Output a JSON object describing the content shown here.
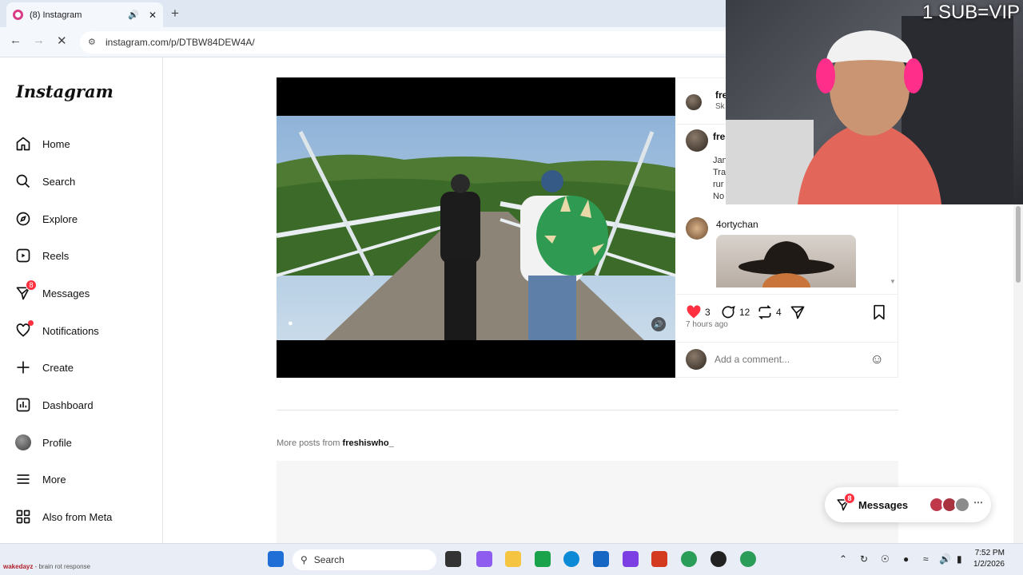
{
  "browser": {
    "tab_title": "(8) Instagram",
    "url": "instagram.com/p/DTBW84DEW4A/"
  },
  "sidebar": {
    "logo": "Instagram",
    "items": [
      {
        "label": "Home",
        "icon": "home-icon"
      },
      {
        "label": "Search",
        "icon": "search-icon"
      },
      {
        "label": "Explore",
        "icon": "compass-icon"
      },
      {
        "label": "Reels",
        "icon": "reels-icon"
      },
      {
        "label": "Messages",
        "icon": "messenger-icon",
        "badge": "8"
      },
      {
        "label": "Notifications",
        "icon": "heart-icon"
      },
      {
        "label": "Create",
        "icon": "plus-icon"
      },
      {
        "label": "Dashboard",
        "icon": "dashboard-icon"
      },
      {
        "label": "Profile",
        "icon": "avatar-icon"
      },
      {
        "label": "More",
        "icon": "menu-icon"
      },
      {
        "label": "Also from Meta",
        "icon": "meta-icon"
      }
    ]
  },
  "post": {
    "header_user": "fre",
    "header_sub": "Sk",
    "caption_user": "fre",
    "caption_lines": [
      "Jan",
      "Tra",
      "rur",
      "No"
    ],
    "comment_user": "4ortychan",
    "likes": "3",
    "comments": "12",
    "reposts": "4",
    "time_ago": "7 hours ago",
    "comment_placeholder": "Add a comment...",
    "more_posts_prefix": "More posts from",
    "more_posts_user": "freshiswho_"
  },
  "floating_messages": {
    "label": "Messages",
    "badge": "8"
  },
  "webcam": {
    "overlay_text": "1 SUB=VIP"
  },
  "taskbar": {
    "search_label": "Search",
    "time": "7:52 PM",
    "date": "1/2/2026",
    "ticker_user": "wakedayz",
    "ticker_text": "- brain rot response"
  }
}
